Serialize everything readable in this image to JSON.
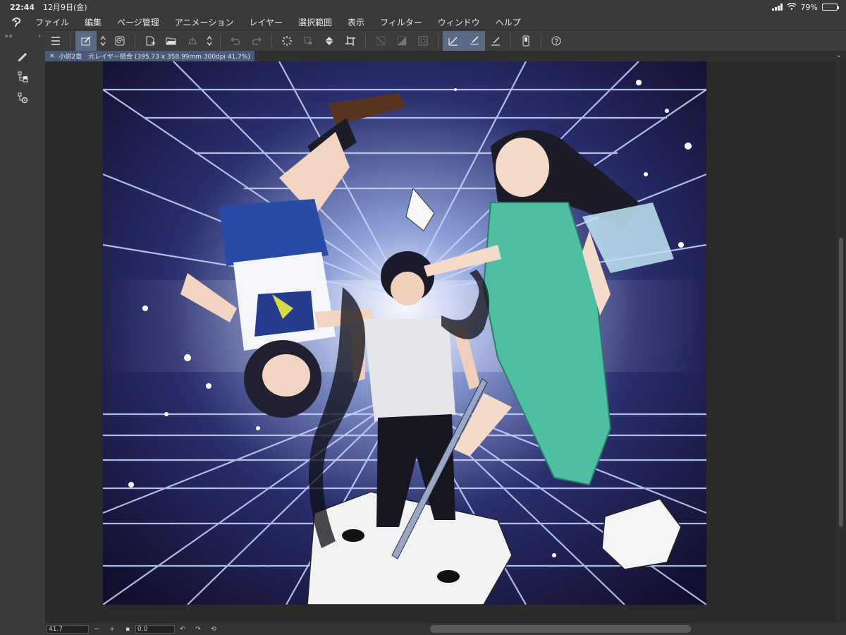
{
  "status": {
    "time": "22:44",
    "date": "12月9日(金)",
    "battery": "79%",
    "battery_level": 0.79
  },
  "menu": {
    "items": [
      "ファイル",
      "編集",
      "ページ管理",
      "アニメーション",
      "レイヤー",
      "選択範囲",
      "表示",
      "フィルター",
      "ウィンドウ",
      "ヘルプ"
    ]
  },
  "tab": {
    "title": "小説2章　元レイヤー結合 (395.73 x 358.99mm 300dpi 41.7%)"
  },
  "bottom": {
    "zoom": "41.7",
    "rotation": "0.0"
  },
  "colors": {
    "accent": "#5b6b86",
    "tab": "#4a5a78"
  }
}
